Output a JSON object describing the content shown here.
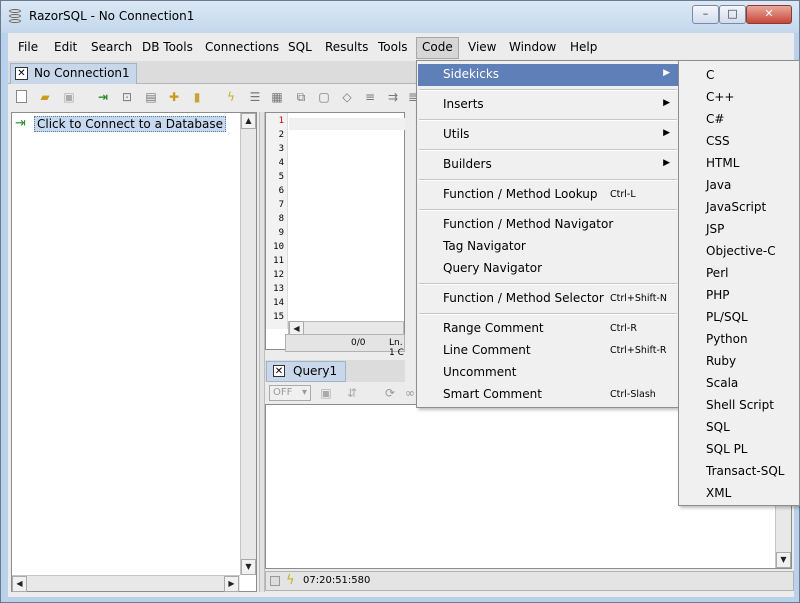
{
  "window": {
    "title": "RazorSQL - No Connection1",
    "min_glyph": "–",
    "max_glyph": "□",
    "close_glyph": "✕"
  },
  "menubar": {
    "items": [
      "File",
      "Edit",
      "Search",
      "DB Tools",
      "Connections",
      "SQL",
      "Results",
      "Tools",
      "Code",
      "View",
      "Window",
      "Help"
    ],
    "active": "Code"
  },
  "connection_tab": {
    "label": "No Connection1"
  },
  "tree": {
    "node_label": "Click to Connect to a Database"
  },
  "editor": {
    "line_numbers": [
      "1",
      "2",
      "3",
      "4",
      "5",
      "6",
      "7",
      "8",
      "9",
      "10",
      "11",
      "12",
      "13",
      "14",
      "15"
    ],
    "position": "0/0",
    "line_col": "Ln. 1 C"
  },
  "query_tab": {
    "label": "Query1",
    "mode_select": "OFF"
  },
  "status_bar": {
    "time": "07:20:51:580"
  },
  "code_menu": {
    "items": [
      {
        "label": "Sidekicks",
        "submenu": true,
        "highlighted": true
      },
      {
        "label": "Inserts",
        "submenu": true
      },
      {
        "label": "Utils",
        "submenu": true
      },
      {
        "label": "Builders",
        "submenu": true
      },
      {
        "label": "Function / Method Lookup",
        "shortcut": "Ctrl-L"
      },
      {
        "label": "Function / Method Navigator"
      },
      {
        "label": "Tag Navigator"
      },
      {
        "label": "Query Navigator"
      },
      {
        "label": "Function / Method Selector",
        "shortcut": "Ctrl+Shift-N"
      },
      {
        "label": "Range Comment",
        "shortcut": "Ctrl-R"
      },
      {
        "label": "Line Comment",
        "shortcut": "Ctrl+Shift-R"
      },
      {
        "label": "Uncomment"
      },
      {
        "label": "Smart Comment",
        "shortcut": "Ctrl-Slash"
      }
    ],
    "submenu_arrow": "▶"
  },
  "sidekicks_submenu": {
    "items": [
      "C",
      "C++",
      "C#",
      "CSS",
      "HTML",
      "Java",
      "JavaScript",
      "JSP",
      "Objective-C",
      "Perl",
      "PHP",
      "PL/SQL",
      "Python",
      "Ruby",
      "Scala",
      "Shell Script",
      "SQL",
      "SQL PL",
      "Transact-SQL",
      "XML"
    ]
  },
  "icons": {
    "app": "razorsql-icon",
    "connect": "connect-database-icon",
    "highlight_color": "#5e7fb8"
  }
}
